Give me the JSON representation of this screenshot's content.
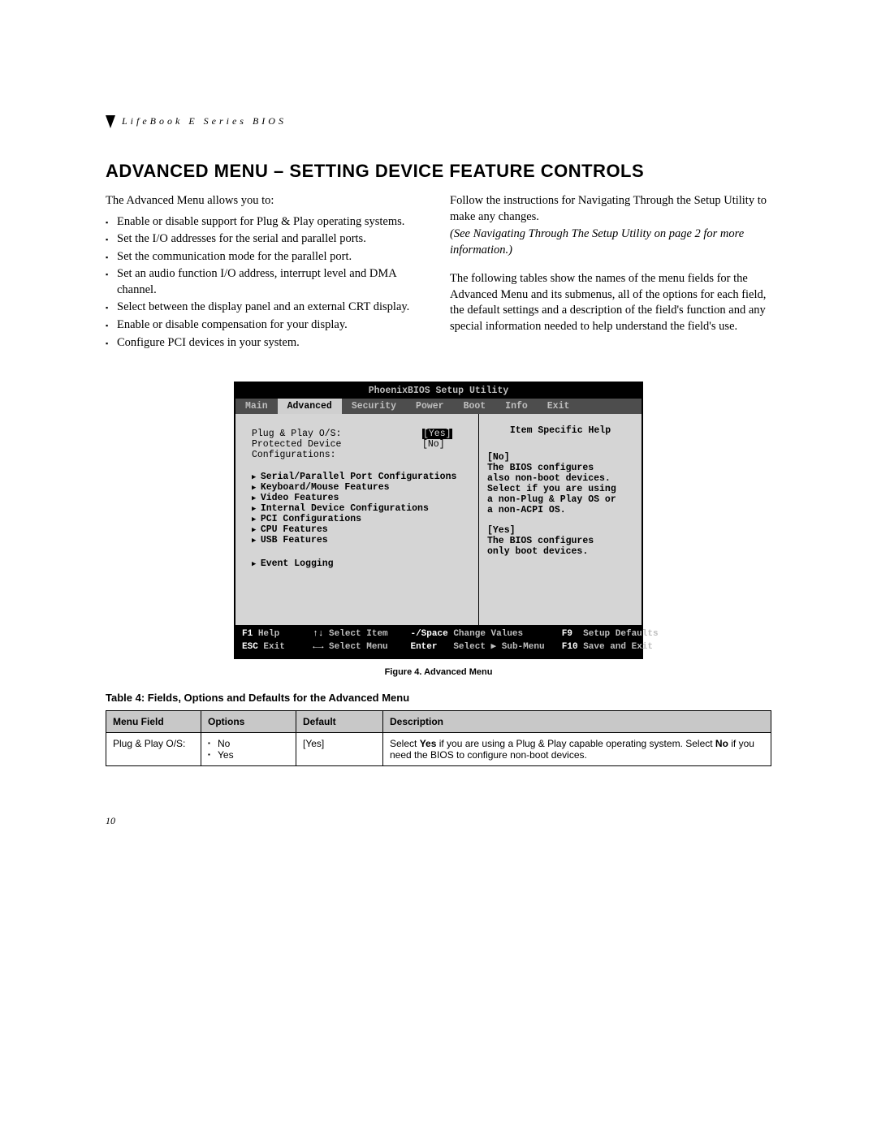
{
  "header": {
    "running": "LifeBook E Series BIOS"
  },
  "title": "ADVANCED MENU – SETTING DEVICE FEATURE CONTROLS",
  "intro": "The Advanced Menu allows you to:",
  "bullets": [
    "Enable or disable support for Plug & Play operating systems.",
    "Set the I/O addresses for the serial and parallel ports.",
    "Set the communication mode for the parallel port.",
    "Set an audio function I/O address, interrupt level and DMA channel.",
    "Select between the display panel and an external CRT display.",
    "Enable or disable compensation for your display.",
    "Configure PCI devices in your system."
  ],
  "right": {
    "p1": "Follow the instructions for Navigating Through the Setup Utility to make any changes.",
    "p2": "(See Navigating Through The Setup Utility on page 2 for more information.)",
    "p3": "The following tables show the names of the menu fields for the Advanced Menu and its submenus, all of the options for each field, the default settings and a description of the field's function and any special information needed to help understand the field's use."
  },
  "bios": {
    "title": "PhoenixBIOS Setup Utility",
    "menu": [
      "Main",
      "Advanced",
      "Security",
      "Power",
      "Boot",
      "Info",
      "Exit"
    ],
    "menu_active": 1,
    "fields": [
      {
        "label": "Plug & Play O/S:",
        "value": "[Yes]",
        "selected": true
      },
      {
        "label": "Protected Device Configurations:",
        "value": "[No]",
        "selected": false
      }
    ],
    "submenus": [
      "Serial/Parallel Port Configurations",
      "Keyboard/Mouse Features",
      "Video Features",
      "Internal Device Configurations",
      "PCI Configurations",
      "CPU Features",
      "USB Features"
    ],
    "submenus2": [
      "Event Logging"
    ],
    "help_title": "Item Specific Help",
    "help_lines": [
      "[No]",
      "The BIOS configures",
      "also non-boot devices.",
      "Select if you are using",
      "a non-Plug & Play OS or",
      "a non-ACPI OS.",
      "",
      "[Yes]",
      "The BIOS configures",
      "only boot devices."
    ],
    "foot": {
      "r1": [
        {
          "k": "F1",
          "t": "Help"
        },
        {
          "k": "↑↓",
          "t": "Select Item"
        },
        {
          "k": "-/Space",
          "t": "Change Values"
        },
        {
          "k": "F9",
          "t": "Setup Defaults"
        }
      ],
      "r2": [
        {
          "k": "ESC",
          "t": "Exit"
        },
        {
          "k": "←→",
          "t": "Select Menu"
        },
        {
          "k": "Enter",
          "t": "Select ▶ Sub-Menu"
        },
        {
          "k": "F10",
          "t": "Save and Exit"
        }
      ]
    }
  },
  "figure_caption": "Figure 4.  Advanced Menu",
  "table_caption": "Table 4: Fields, Options and Defaults for the Advanced Menu",
  "table": {
    "headers": [
      "Menu Field",
      "Options",
      "Default",
      "Description"
    ],
    "row": {
      "field": "Plug & Play O/S:",
      "options": [
        "No",
        "Yes"
      ],
      "default": "[Yes]",
      "desc_a": "Select ",
      "desc_b1": "Yes",
      "desc_c": " if you are using a Plug & Play capable operating system. Select ",
      "desc_b2": "No",
      "desc_d": " if you need the BIOS to configure non-boot devices."
    }
  },
  "pagenum": "10"
}
